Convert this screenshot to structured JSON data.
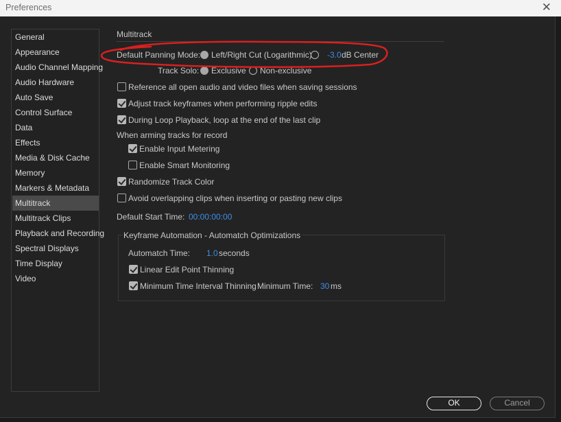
{
  "window": {
    "title": "Preferences"
  },
  "sidebar": {
    "items": [
      {
        "label": "General",
        "selected": false
      },
      {
        "label": "Appearance",
        "selected": false
      },
      {
        "label": "Audio Channel Mapping",
        "selected": false
      },
      {
        "label": "Audio Hardware",
        "selected": false
      },
      {
        "label": "Auto Save",
        "selected": false
      },
      {
        "label": "Control Surface",
        "selected": false
      },
      {
        "label": "Data",
        "selected": false
      },
      {
        "label": "Effects",
        "selected": false
      },
      {
        "label": "Media & Disk Cache",
        "selected": false
      },
      {
        "label": "Memory",
        "selected": false
      },
      {
        "label": "Markers & Metadata",
        "selected": false
      },
      {
        "label": "Multitrack",
        "selected": true
      },
      {
        "label": "Multitrack Clips",
        "selected": false
      },
      {
        "label": "Playback and Recording",
        "selected": false
      },
      {
        "label": "Spectral Displays",
        "selected": false
      },
      {
        "label": "Time Display",
        "selected": false
      },
      {
        "label": "Video",
        "selected": false
      }
    ]
  },
  "panel": {
    "section_title": "Multitrack",
    "panning": {
      "label": "Default Panning Mode:",
      "option1": "Left/Right Cut (Logarithmic)",
      "option1_selected": true,
      "option2_value": "-3.0",
      "option2_suffix": "dB Center",
      "option2_selected": false
    },
    "track_solo": {
      "label": "Track Solo:",
      "option1": "Exclusive",
      "option1_selected": true,
      "option2": "Non-exclusive",
      "option2_selected": false
    },
    "options": {
      "reference_files": {
        "label": "Reference all open audio and video files when saving sessions",
        "checked": false
      },
      "adjust_keyframes": {
        "label": "Adjust track keyframes when performing ripple edits",
        "checked": true
      },
      "loop_playback": {
        "label": "During Loop Playback, loop at the end of the last clip",
        "checked": true
      },
      "arming_heading": "When arming tracks for record",
      "input_metering": {
        "label": "Enable Input Metering",
        "checked": true
      },
      "smart_monitoring": {
        "label": "Enable Smart Monitoring",
        "checked": false
      },
      "randomize_color": {
        "label": "Randomize Track Color",
        "checked": true
      },
      "avoid_overlap": {
        "label": "Avoid overlapping clips when inserting or pasting new clips",
        "checked": false
      }
    },
    "start_time": {
      "label": "Default Start Time:",
      "value": "00:00:00:00"
    },
    "automation": {
      "title": "Keyframe Automation - Automatch Optimizations",
      "automatch_label": "Automatch Time:",
      "automatch_value": "1.0",
      "automatch_unit": "seconds",
      "linear_thinning": {
        "label": "Linear Edit Point Thinning",
        "checked": true
      },
      "min_interval": {
        "label": "Minimum Time Interval Thinning",
        "checked": true
      },
      "min_time_label": "Minimum Time:",
      "min_time_value": "30",
      "min_time_unit": "ms"
    }
  },
  "buttons": {
    "ok": "OK",
    "cancel": "Cancel"
  },
  "colors": {
    "accent_blue": "#3f8ee6",
    "annotation_red": "#d92020",
    "selected_item_bg": "#4a4a4a"
  },
  "icons": {
    "close": "close-icon",
    "check": "check-icon"
  }
}
